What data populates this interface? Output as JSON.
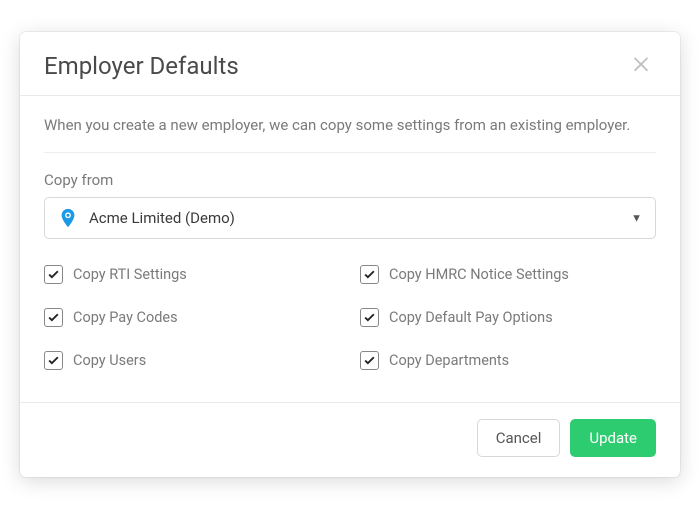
{
  "modal": {
    "title": "Employer Defaults",
    "description": "When you create a new employer, we can copy some settings from an existing employer.",
    "copy_from_label": "Copy from",
    "selected_employer": "Acme Limited (Demo)",
    "checkboxes": {
      "rti": "Copy RTI Settings",
      "hmrc": "Copy HMRC Notice Settings",
      "paycodes": "Copy Pay Codes",
      "payoptions": "Copy Default Pay Options",
      "users": "Copy Users",
      "departments": "Copy Departments"
    },
    "buttons": {
      "cancel": "Cancel",
      "update": "Update"
    }
  }
}
